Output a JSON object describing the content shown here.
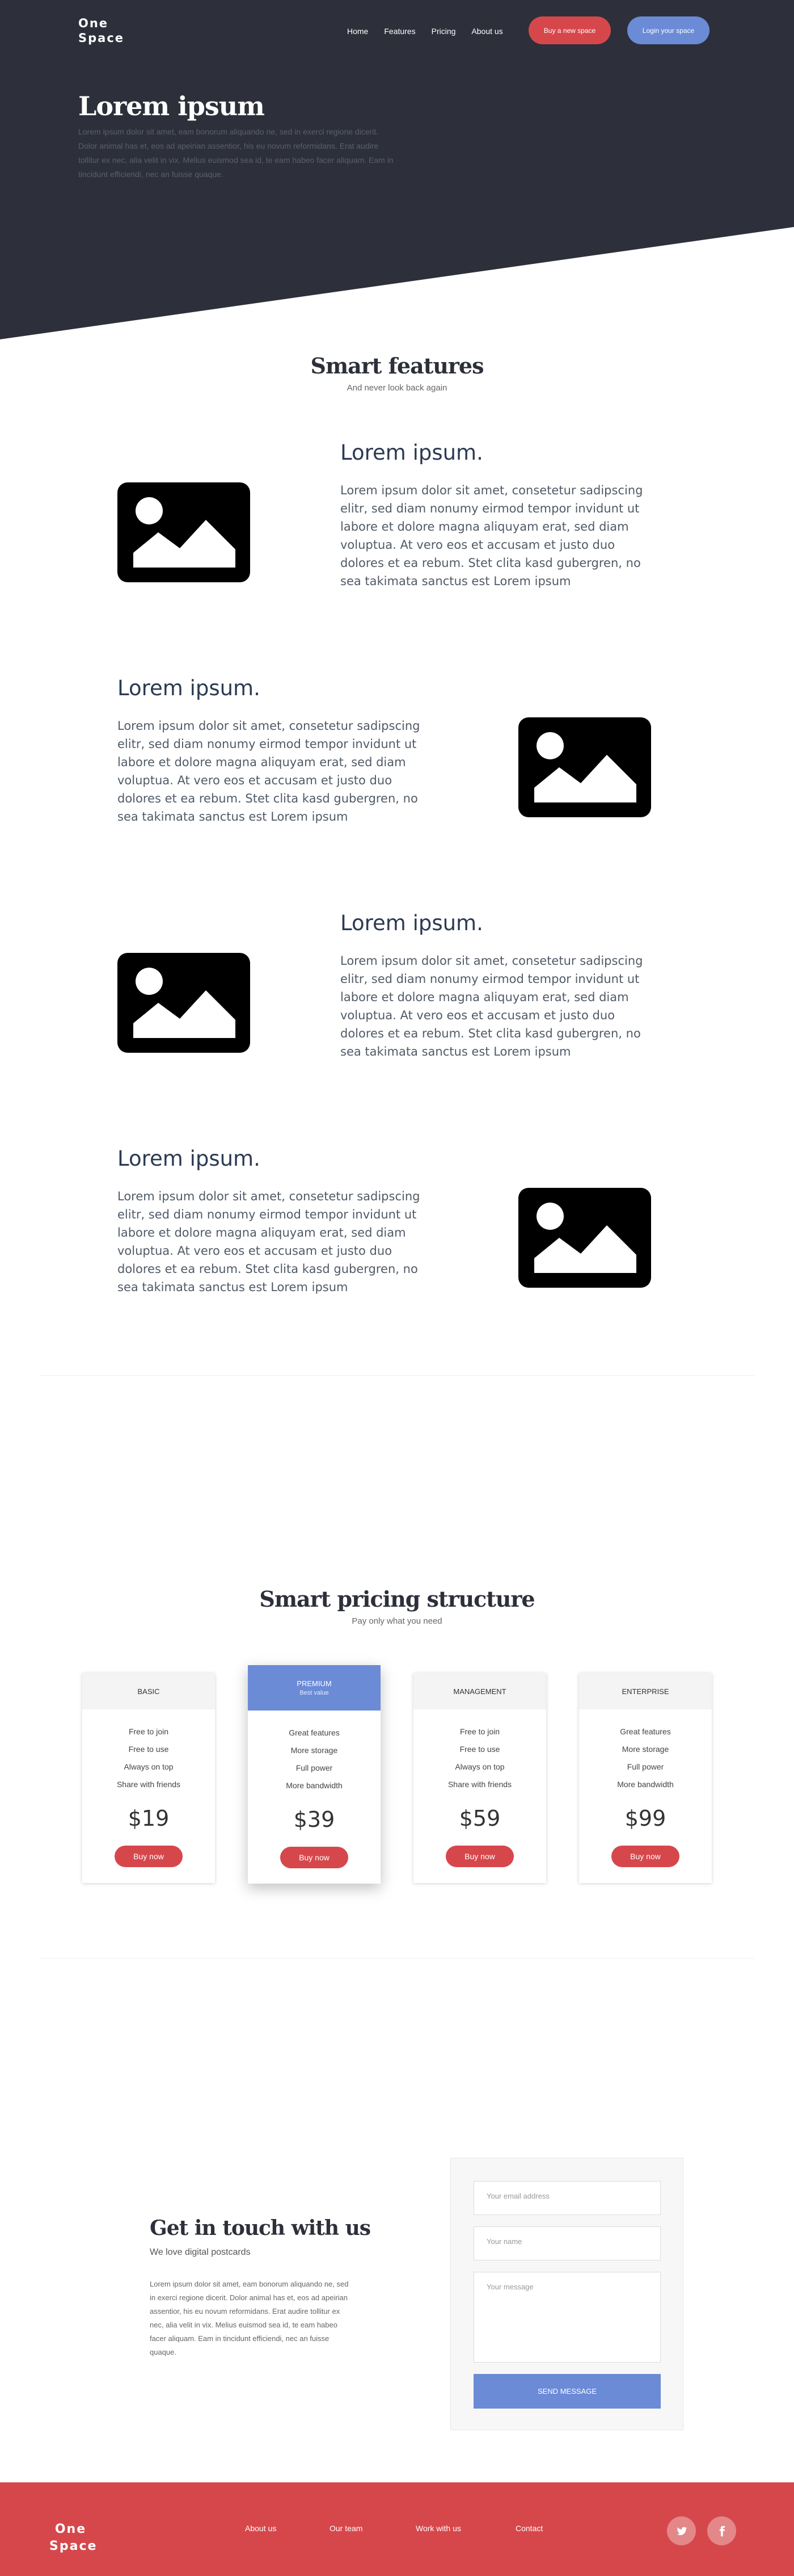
{
  "header": {
    "logo_line1": "One",
    "logo_line2": "Space",
    "nav": [
      "Home",
      "Features",
      "Pricing",
      "About us"
    ],
    "buy_button": "Buy a new space",
    "login_button": "Login your space",
    "title": "Lorem ipsum",
    "text": "Lorem ipsum dolor sit amet, eam bonorum aliquando ne, sed in exerci regione dicerit. Dolor animal has et, eos ad apeirian assentior, his eu novum reformidans. Erat audire tollitur ex nec, alia velit in vix. Melius euismod sea id, te eam habeo facer aliquam. Eam in tincidunt efficiendi, nec an fuisse quaque."
  },
  "features": {
    "title": "Smart features",
    "subtitle": "And never look back again",
    "items": [
      {
        "heading": "Lorem ipsum.",
        "text": "Lorem ipsum dolor sit amet, consetetur sadipscing elitr, sed diam nonumy eirmod tempor invidunt ut labore et dolore magna aliquyam erat, sed diam voluptua. At vero eos et accusam et justo duo dolores et ea rebum. Stet clita kasd gubergren, no sea takimata sanctus est Lorem ipsum",
        "icon": "image-icon"
      },
      {
        "heading": "Lorem ipsum.",
        "text": "Lorem ipsum dolor sit amet, consetetur sadipscing elitr, sed diam nonumy eirmod tempor invidunt ut labore et dolore magna aliquyam erat, sed diam voluptua. At vero eos et accusam et justo duo dolores et ea rebum. Stet clita kasd gubergren, no sea takimata sanctus est Lorem ipsum",
        "icon": "image-icon"
      },
      {
        "heading": "Lorem ipsum.",
        "text": "Lorem ipsum dolor sit amet, consetetur sadipscing elitr, sed diam nonumy eirmod tempor invidunt ut labore et dolore magna aliquyam erat, sed diam voluptua. At vero eos et accusam et justo duo dolores et ea rebum. Stet clita kasd gubergren, no sea takimata sanctus est Lorem ipsum",
        "icon": "image-icon"
      },
      {
        "heading": "Lorem ipsum.",
        "text": "Lorem ipsum dolor sit amet, consetetur sadipscing elitr, sed diam nonumy eirmod tempor invidunt ut labore et dolore magna aliquyam erat, sed diam voluptua. At vero eos et accusam et justo duo dolores et ea rebum. Stet clita kasd gubergren, no sea takimata sanctus est Lorem ipsum",
        "icon": "image-icon"
      }
    ]
  },
  "pricing": {
    "title": "Smart pricing structure",
    "subtitle": "Pay only what you need",
    "plans": [
      {
        "name": "Basic",
        "badge": "",
        "features": [
          "Free to join",
          "Free to use",
          "Always on top",
          "Share with friends"
        ],
        "price": "$19",
        "button": "Buy now"
      },
      {
        "name": "Premium",
        "badge": "Best value",
        "features": [
          "Great features",
          "More storage",
          "Full power",
          "More bandwidth"
        ],
        "price": "$39",
        "button": "Buy now"
      },
      {
        "name": "Management",
        "badge": "",
        "features": [
          "Free to join",
          "Free to use",
          "Always on top",
          "Share with friends"
        ],
        "price": "$59",
        "button": "Buy now"
      },
      {
        "name": "Enterprise",
        "badge": "",
        "features": [
          "Great features",
          "More storage",
          "Full power",
          "More bandwidth"
        ],
        "price": "$99",
        "button": "Buy now"
      }
    ]
  },
  "contact": {
    "title": "Get in touch with us",
    "subtitle": "We love digital postcards",
    "text": "Lorem ipsum dolor sit amet, eam bonorum aliquando ne, sed in exerci regione dicerit. Dolor animal has et, eos ad apeirian assentior, his eu novum reformidans. Erat audire tollitur ex nec, alia velit in vix. Melius euismod sea id, te eam habeo facer aliquam. Eam in tincidunt efficiendi, nec an fuisse quaque.",
    "email_placeholder": "Your email address",
    "name_placeholder": "Your name",
    "message_placeholder": "Your message",
    "send_button": "SEND MESSAGE"
  },
  "footer": {
    "logo_line1": "One",
    "logo_line2": "Space",
    "links": [
      "About us",
      "Our team",
      "Work with us",
      "Contact"
    ],
    "social": [
      "twitter-icon",
      "facebook-icon"
    ]
  },
  "colors": {
    "hero_dark": "#2d303a",
    "accent_red": "#d6474b",
    "accent_blue": "#6b8bd7"
  }
}
